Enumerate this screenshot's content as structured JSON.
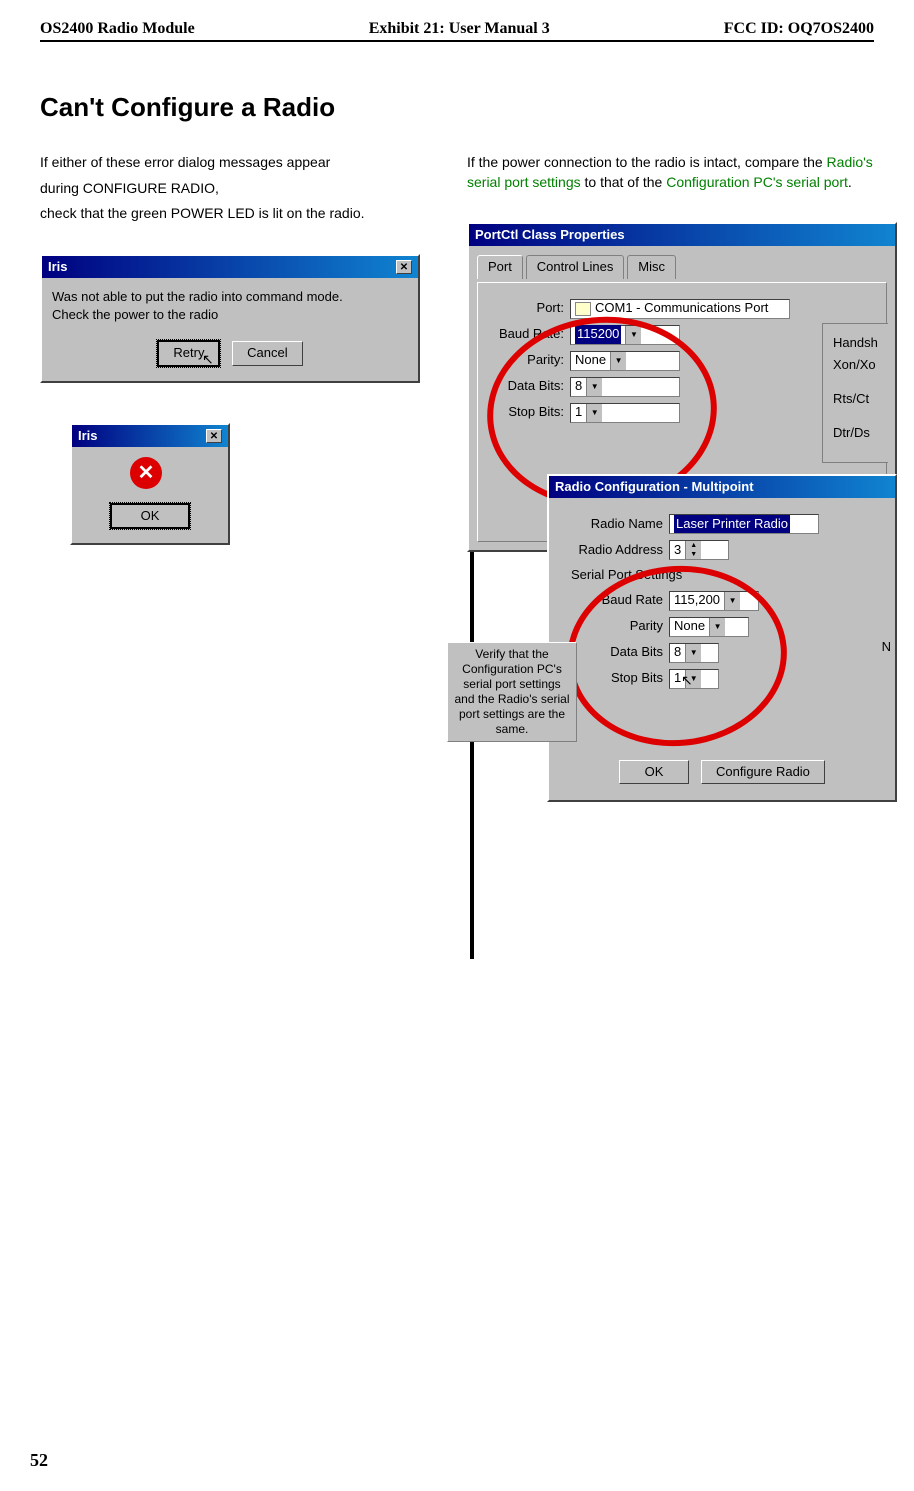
{
  "header": {
    "left": "OS2400 Radio Module",
    "center": "Exhibit 21: User Manual 3",
    "right": "FCC ID: OQ7OS2400"
  },
  "section_title": "Can't Configure a Radio",
  "left_col": {
    "p1": "If either of these error dialog messages appear",
    "p2": "during CONFIGURE RADIO,",
    "p3": "check that the green POWER LED is lit on the radio."
  },
  "right_col": {
    "intro_pre": "If the power connection to the radio is intact, compare the ",
    "intro_link1": "Radio's serial port settings",
    "intro_mid": " to that of the ",
    "intro_link2": "Configuration PC's serial port",
    "intro_post": "."
  },
  "dlg1": {
    "title": "Iris",
    "msg1": "Was not able to put the radio into command mode.",
    "msg2": "Check the power to the radio",
    "btn_retry": "Retry",
    "btn_cancel": "Cancel"
  },
  "dlg2": {
    "title": "Iris",
    "btn_ok": "OK"
  },
  "portctl": {
    "title": "PortCtl Class Properties",
    "tabs": {
      "port": "Port",
      "control": "Control Lines",
      "misc": "Misc"
    },
    "labels": {
      "port": "Port:",
      "baud": "Baud Rate:",
      "parity": "Parity:",
      "data": "Data Bits:",
      "stop": "Stop Bits:"
    },
    "values": {
      "port": "COM1 - Communications Port",
      "baud": "115200",
      "parity": "None",
      "data": "8",
      "stop": "1"
    },
    "right_labels": {
      "handsh": "Handsh",
      "xon": "Xon/Xo",
      "rts": "Rts/Ct",
      "dtr": "Dtr/Ds"
    }
  },
  "radiocfg": {
    "title": "Radio Configuration - Multipoint",
    "labels": {
      "name": "Radio Name",
      "addr": "Radio Address",
      "group": "Serial Port Settings",
      "baud": "Baud Rate",
      "parity": "Parity",
      "data": "Data Bits",
      "stop": "Stop Bits"
    },
    "values": {
      "name": "Laser Printer Radio",
      "addr": "3",
      "baud": "115,200",
      "parity": "None",
      "data": "8",
      "stop_display": "1"
    },
    "buttons": {
      "ok": "OK",
      "cfg": "Configure Radio"
    },
    "right_n": "N"
  },
  "note": {
    "l1": "Verify that the",
    "l2": "Configuration PC's",
    "l3": "serial port settings",
    "l4": "and the Radio's serial",
    "l5": "port settings are the",
    "l6": "same."
  },
  "page_number": "52"
}
